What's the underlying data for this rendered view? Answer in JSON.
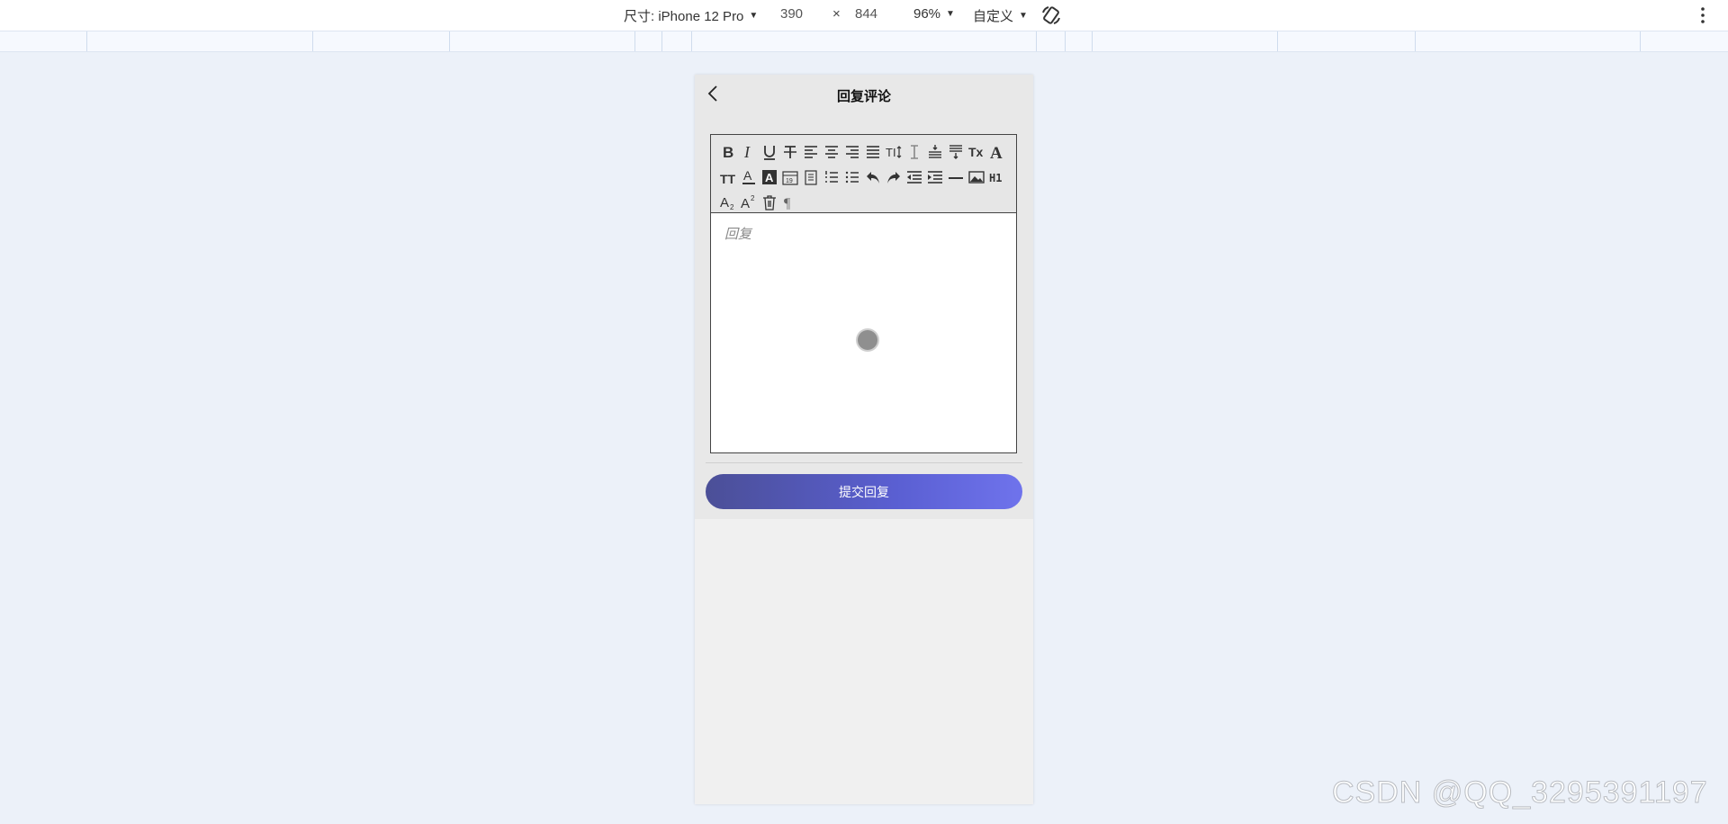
{
  "devtools": {
    "device_label": "尺寸: iPhone 12 Pro",
    "width": "390",
    "times": "×",
    "height": "844",
    "zoom": "96%",
    "throttle": "自定义"
  },
  "page": {
    "title": "回复评论",
    "editor": {
      "placeholder": "回复",
      "toolbar": [
        {
          "name": "bold-icon"
        },
        {
          "name": "italic-icon"
        },
        {
          "name": "underline-icon"
        },
        {
          "name": "strikethrough-icon"
        },
        {
          "name": "align-left-icon"
        },
        {
          "name": "align-center-icon"
        },
        {
          "name": "align-right-icon"
        },
        {
          "name": "align-justify-icon"
        },
        {
          "name": "letter-spacing-icon",
          "text": "TI"
        },
        {
          "name": "line-height-icon"
        },
        {
          "name": "space-before-icon"
        },
        {
          "name": "space-after-icon"
        },
        {
          "name": "clear-format-icon",
          "text": "Tx"
        },
        {
          "name": "font-family-icon",
          "text": "A"
        },
        {
          "name": "font-size-icon",
          "text": "TT"
        },
        {
          "name": "text-color-icon",
          "text": "A"
        },
        {
          "name": "background-color-icon",
          "text": "A"
        },
        {
          "name": "date-icon",
          "text": "19"
        },
        {
          "name": "time-icon"
        },
        {
          "name": "ordered-list-icon"
        },
        {
          "name": "bullet-list-icon"
        },
        {
          "name": "undo-icon"
        },
        {
          "name": "redo-icon"
        },
        {
          "name": "outdent-icon"
        },
        {
          "name": "indent-icon"
        },
        {
          "name": "divider-icon"
        },
        {
          "name": "image-icon"
        },
        {
          "name": "heading-icon",
          "text": "H1"
        },
        {
          "name": "subscript-icon",
          "text": "A"
        },
        {
          "name": "superscript-icon",
          "text": "A"
        },
        {
          "name": "clear-icon"
        },
        {
          "name": "paragraph-icon",
          "text": "¶"
        }
      ]
    },
    "submit_label": "提交回复"
  },
  "watermark": "CSDN @QQ_3295391197"
}
